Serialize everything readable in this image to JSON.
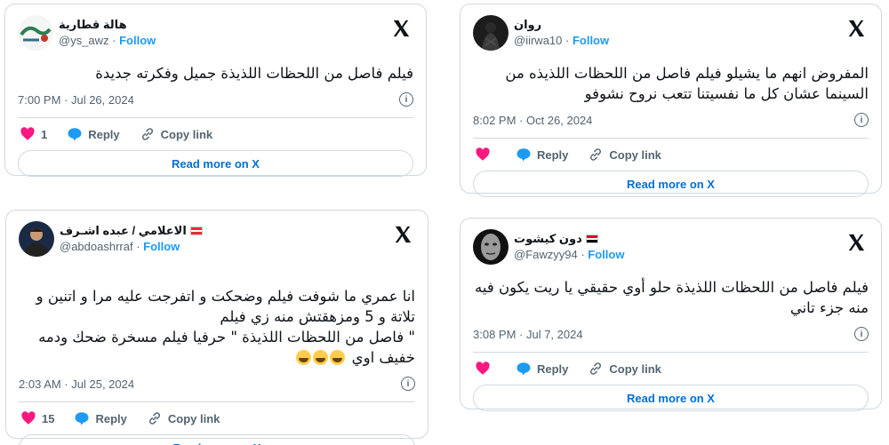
{
  "action_labels": {
    "reply": "Reply",
    "copy_link": "Copy link",
    "read_more": "Read more on X"
  },
  "tweets": [
    {
      "name": "هالة قطارية",
      "handle": "@ys_awz",
      "follow": "Follow",
      "text": "فيلم فاصل من اللحظات اللذيذة جميل وفكرته جديدة",
      "date": "7:00 PM · Jul 26, 2024",
      "likes": "1",
      "flag": ""
    },
    {
      "name": "روان",
      "handle": "@iirwa10",
      "follow": "Follow",
      "text": "المفروض انهم ما يشيلو فيلم فاصل من اللحظات اللذيذه من السينما عشان كل ما نفسيتنا تتعب نروح نشوفو",
      "date": "8:02 PM · Oct 26, 2024",
      "likes": "",
      "flag": ""
    },
    {
      "name": "الاعلامي / عبده اشـرف",
      "handle": "@abdoashrraf",
      "follow": "Follow",
      "text": "انا عمري ما شوفت فيلم وضحكت و اتفرجت عليه مرا و اتنين و تلاتة و 5 ومزهقتش منه زي فيلم\n\" فاصل من اللحظات اللذيذة \" حرفيا فيلم مسخرة ضحك ودمه خفيف اوي ",
      "date": "2:03 AM · Jul 25, 2024",
      "likes": "15",
      "flag": "austria"
    },
    {
      "name": "دون كيشوت",
      "handle": "@Fawzyy94",
      "follow": "Follow",
      "text": "فيلم فاصل من اللحظات اللذيذة حلو أوي حقيقي يا ريت يكون فيه منه جزء تاني",
      "date": "3:08 PM · Jul 7, 2024",
      "likes": "",
      "flag": "egypt"
    }
  ],
  "colors": {
    "heart": "#f91880",
    "bubble": "#1d9bf0",
    "link": "#006fd6",
    "muted": "#536471"
  },
  "icons": [
    "x-logo",
    "info-icon",
    "heart-icon",
    "reply-bubble-icon",
    "link-icon",
    "laughing-emoji"
  ]
}
